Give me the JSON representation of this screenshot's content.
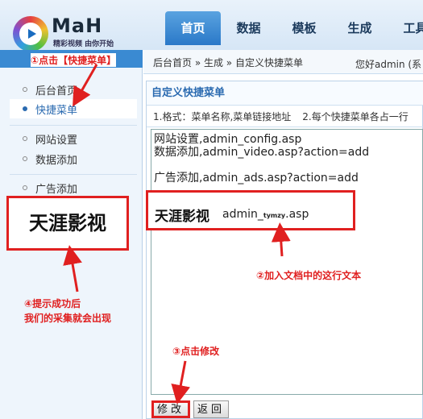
{
  "header": {
    "logo_text": "MaH",
    "logo_slogan": "精彩视频 由你开始",
    "tabs": [
      {
        "label": "首页",
        "active": true
      },
      {
        "label": "数据",
        "active": false
      },
      {
        "label": "模板",
        "active": false
      },
      {
        "label": "生成",
        "active": false
      },
      {
        "label": "工具",
        "active": false
      }
    ]
  },
  "sidebar": {
    "items": [
      {
        "label": "后台首页",
        "active": false
      },
      {
        "label": "快捷菜单",
        "active": true
      },
      {
        "label": "网站设置",
        "active": false
      },
      {
        "label": "数据添加",
        "active": false
      },
      {
        "label": "广告添加",
        "active": false
      }
    ],
    "result_text": "天涯影视"
  },
  "main": {
    "breadcrumb": "后台首页 » 生成 » 自定义快捷菜单",
    "greeting": "您好admin (系",
    "panel_title": "自定义快捷菜单",
    "hint1": "1.格式：菜单名称,菜单链接地址",
    "hint2": "2.每个快捷菜单各占一行",
    "editor_lines": [
      "网站设置,admin_config.asp",
      "数据添加,admin_video.asp?action=add",
      "",
      "广告添加,admin_ads.asp?action=add"
    ],
    "highlight_name": "天涯影视",
    "highlight_url_prefix": "admin_",
    "highlight_url_small": "tymzy",
    "highlight_url_suffix": ".asp",
    "buttons": {
      "modify": "修改",
      "back": "返回"
    }
  },
  "annotations": {
    "step1": "①点击【快捷菜单】",
    "step2": "②加入文档中的这行文本",
    "step3": "③点击修改",
    "step4_line1": "④提示成功后",
    "step4_line2": "我们的采集就会出现"
  },
  "colors": {
    "annotation_red": "#e02020",
    "tab_active": "#2a78c8",
    "link_blue": "#2a6ab0"
  }
}
